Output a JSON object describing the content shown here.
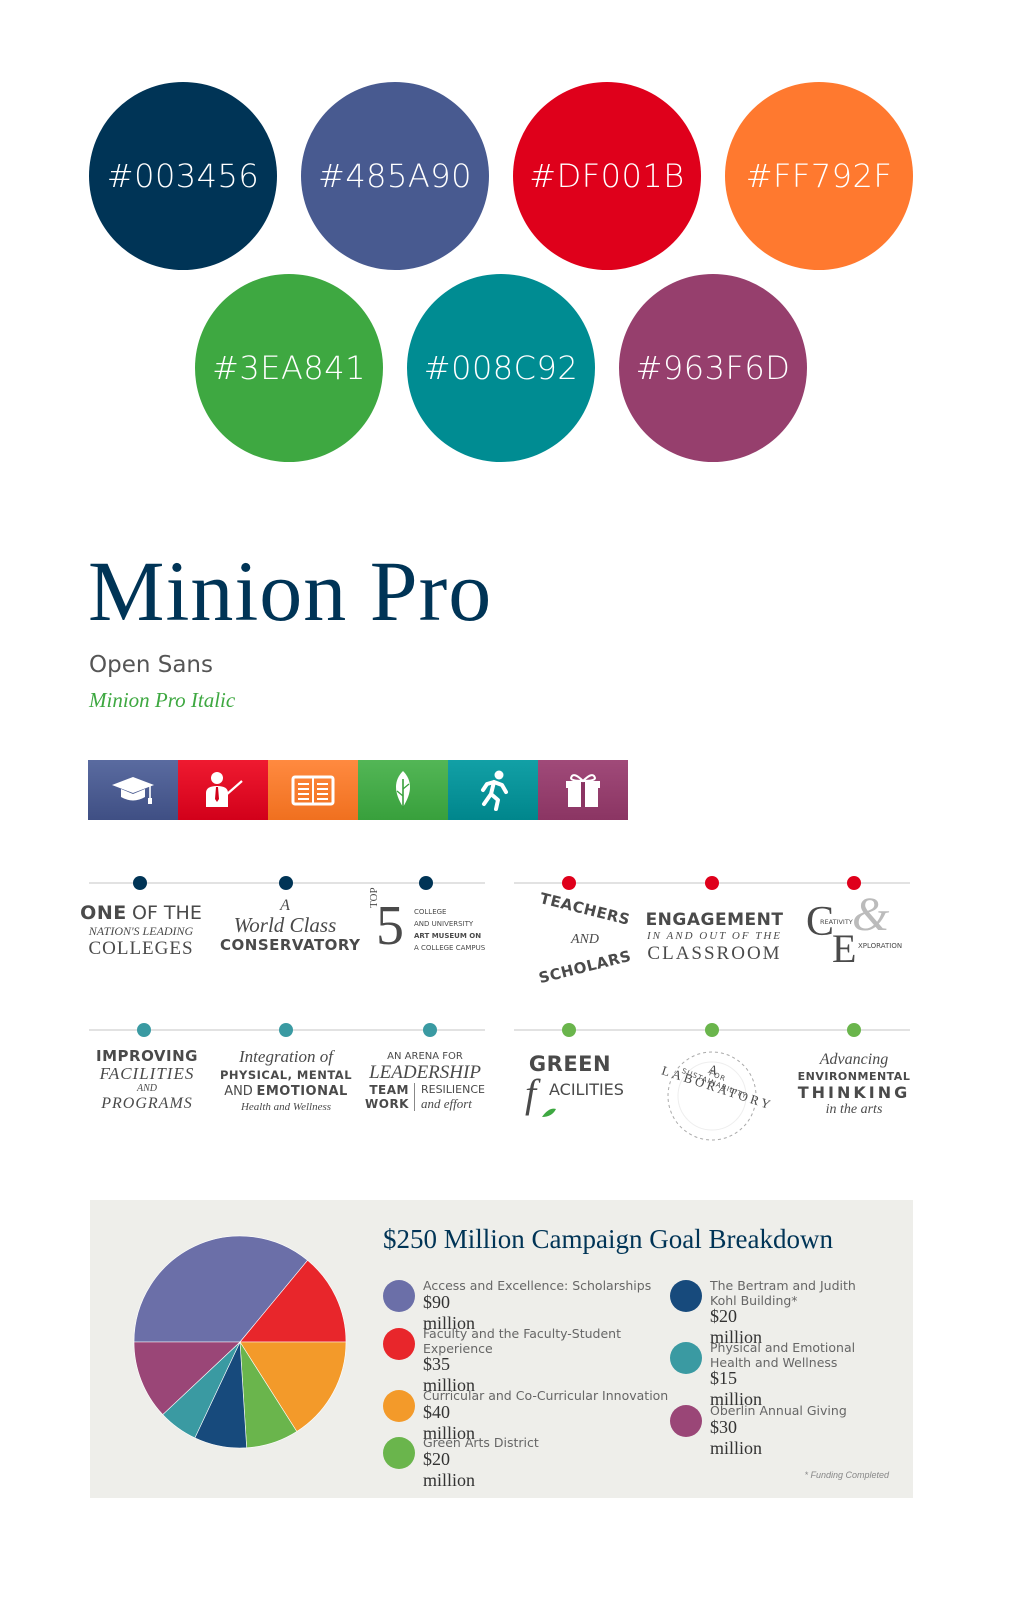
{
  "palette": [
    {
      "hex": "#003456",
      "label": "#003456"
    },
    {
      "hex": "#485A90",
      "label": "#485A90"
    },
    {
      "hex": "#DF001B",
      "label": "#DF001B"
    },
    {
      "hex": "#FF792F",
      "label": "#FF792F"
    },
    {
      "hex": "#3EA841",
      "label": "#3EA841"
    },
    {
      "hex": "#008C92",
      "label": "#008C92"
    },
    {
      "hex": "#963F6D",
      "label": "#963F6D"
    }
  ],
  "typography": {
    "primary": "Minion Pro",
    "secondary": "Open Sans",
    "accent": "Minion Pro Italic"
  },
  "icon_strip": [
    {
      "icon": "graduation-cap-icon",
      "color": "#485A90"
    },
    {
      "icon": "teacher-icon",
      "color": "#DF001B"
    },
    {
      "icon": "open-book-icon",
      "color": "#FF792F"
    },
    {
      "icon": "leaf-icon",
      "color": "#3EA841"
    },
    {
      "icon": "runner-icon",
      "color": "#008C92"
    },
    {
      "icon": "gift-icon",
      "color": "#963F6D"
    }
  ],
  "statements": {
    "one_of": {
      "one": "ONE",
      "of_the": "OF THE",
      "nations": "NATION'S LEADING",
      "colleges": "COLLEGES"
    },
    "world_class": {
      "a": "A",
      "world": "World Class",
      "conservatory": "CONSERVATORY"
    },
    "top5": {
      "top": "TOP",
      "five": "5",
      "l1": "COLLEGE",
      "l2": "AND UNIVERSITY",
      "l3": "ART MUSEUM ON",
      "l4": "A COLLEGE CAMPUS"
    },
    "teachers": {
      "top": "TEACHERS",
      "and": "AND",
      "bottom": "SCHOLARS"
    },
    "engagement": {
      "title": "ENGAGEMENT",
      "sub": "IN AND OUT OF THE",
      "classroom": "CLASSROOM"
    },
    "creativity": {
      "c": "C",
      "reativity": "REATIVITY",
      "amp": "&",
      "e": "E",
      "xploration": "XPLORATION"
    },
    "improving": {
      "improving": "IMPROVING",
      "facilities": "FACILITIES",
      "and": "AND",
      "programs": "PROGRAMS"
    },
    "integration": {
      "l1": "Integration of",
      "l2": "PHYSICAL, MENTAL",
      "l3a": "AND",
      "l3b": "EMOTIONAL",
      "l4": "Health and Wellness"
    },
    "arena": {
      "l1": "AN ARENA FOR",
      "l2": "LEADERSHIP",
      "team": "TEAM",
      "work": "WORK",
      "resilience": "RESILIENCE",
      "effort": "and effort"
    },
    "green": {
      "green": "GREEN",
      "f": "f",
      "acilities": "ACILITIES"
    },
    "laboratory": {
      "top": "A LABORATORY",
      "inner": "FOR SUSTAINABILITY"
    },
    "advancing": {
      "l1": "Advancing",
      "l2": "ENVIRONMENTAL",
      "l3": "THINKING",
      "l4": "in the arts"
    }
  },
  "campaign": {
    "title": "$250 Million Campaign Goal Breakdown",
    "footnote": "* Funding Completed",
    "items": [
      {
        "label": "Access and Excellence: Scholarships",
        "value": "$90 million",
        "color": "#6b6fa8"
      },
      {
        "label": "Faculty and the Faculty-Student Experience",
        "value": "$35 million",
        "color": "#e8262b"
      },
      {
        "label": "Curricular and Co-Curricular Innovation",
        "value": "$40 million",
        "color": "#f39a2a"
      },
      {
        "label": "Green Arts District",
        "value": "$20 million",
        "color": "#6ab54c"
      },
      {
        "label": "The Bertram and Judith Kohl Building*",
        "value": "$20 million",
        "color": "#174a7c"
      },
      {
        "label": "Physical and Emotional Health and Wellness",
        "value": "$15 million",
        "color": "#3a9aa2"
      },
      {
        "label": "Oberlin Annual Giving",
        "value": "$30 million",
        "color": "#9a4677"
      }
    ],
    "chart_data": {
      "type": "pie",
      "categories": [
        "Access and Excellence: Scholarships",
        "Faculty and the Faculty-Student Experience",
        "Curricular and Co-Curricular Innovation",
        "Green Arts District",
        "The Bertram and Judith Kohl Building*",
        "Physical and Emotional Health and Wellness",
        "Oberlin Annual Giving"
      ],
      "values": [
        90,
        35,
        40,
        20,
        20,
        15,
        30
      ],
      "colors": [
        "#6b6fa8",
        "#e8262b",
        "#f39a2a",
        "#6ab54c",
        "#174a7c",
        "#3a9aa2",
        "#9a4677"
      ]
    }
  }
}
